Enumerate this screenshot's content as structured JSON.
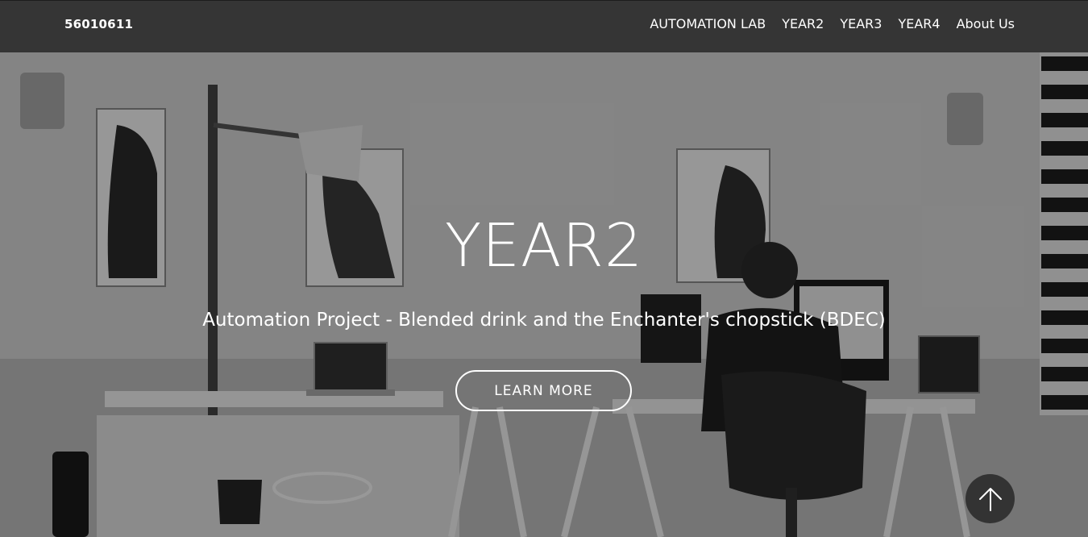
{
  "navbar": {
    "brand": "56010611",
    "links": [
      {
        "label": "AUTOMATION LAB"
      },
      {
        "label": "YEAR2"
      },
      {
        "label": "YEAR3"
      },
      {
        "label": "YEAR4"
      },
      {
        "label": "About Us"
      }
    ]
  },
  "hero": {
    "title": "YEAR2",
    "subtitle": "Automation Project - Blended drink and the Enchanter's chopstick (BDEC)",
    "cta_label": "LEARN MORE",
    "back_to_top_icon": "arrow-up-icon"
  },
  "colors": {
    "navbar_bg": "#353535",
    "text": "#ffffff",
    "overlay": "rgba(0,0,0,0.38)"
  }
}
